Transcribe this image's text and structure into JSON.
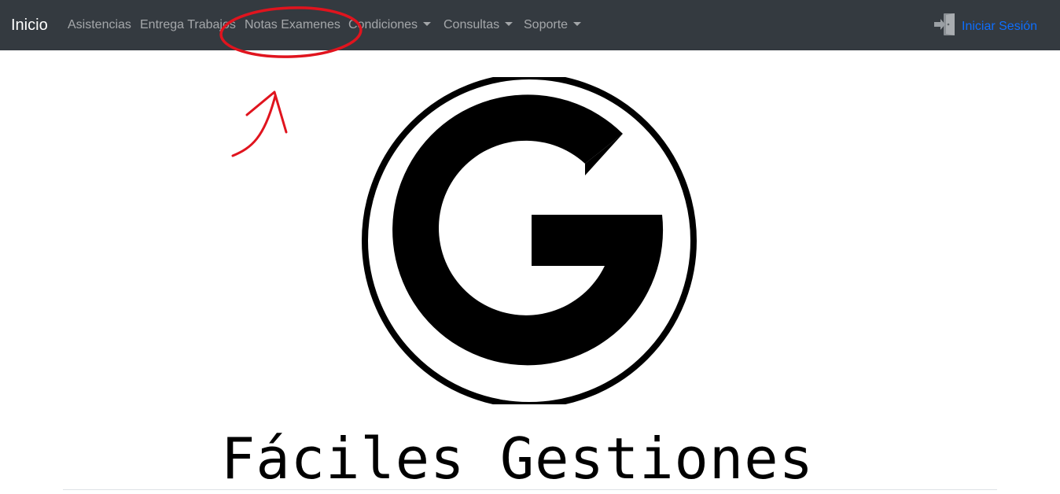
{
  "navbar": {
    "brand": "Inicio",
    "items": [
      {
        "label": "Asistencias"
      },
      {
        "label": "Entrega Trabajos"
      },
      {
        "label": "Notas Examenes"
      },
      {
        "label": "Condiciones"
      },
      {
        "label": "Consultas"
      },
      {
        "label": "Soporte"
      }
    ],
    "login_label": "Iniciar Sesión",
    "login_icon": "door-enter-icon"
  },
  "hero": {
    "logo_letter": "G",
    "tagline": "Fáciles Gestiones"
  },
  "colors": {
    "navbar_bg": "#343a40",
    "nav_text": "rgba(255,255,255,0.55)",
    "login_link": "#0d6efd",
    "annotation": "#e0141e"
  }
}
